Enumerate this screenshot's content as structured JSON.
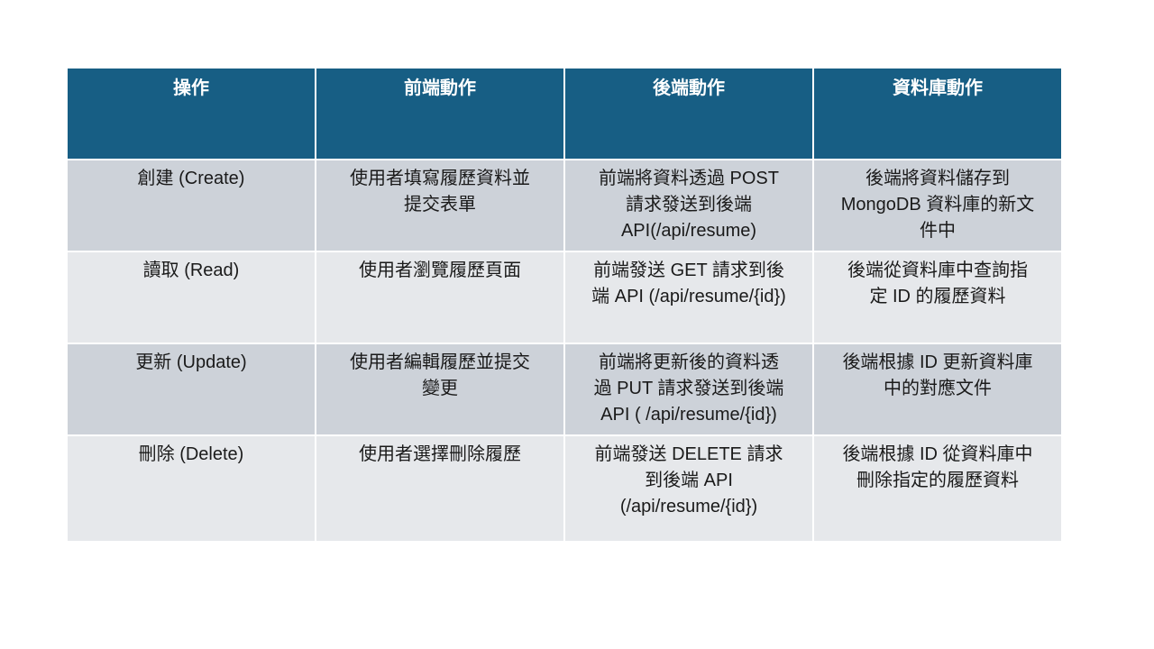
{
  "table": {
    "headers": [
      "操作",
      "前端動作",
      "後端動作",
      "資料庫動作"
    ],
    "rows": [
      [
        [
          "創建 (Create)"
        ],
        [
          "使用者填寫履歷資料並",
          "提交表單"
        ],
        [
          "前端將資料透過 POST",
          "請求發送到後端",
          "API(/api/resume)"
        ],
        [
          "後端將資料儲存到",
          "MongoDB 資料庫的新文",
          "件中"
        ]
      ],
      [
        [
          "讀取 (Read)"
        ],
        [
          "使用者瀏覽履歷頁面"
        ],
        [
          "前端發送 GET 請求到後",
          "端 API (/api/resume/{id})"
        ],
        [
          "後端從資料庫中查詢指",
          "定 ID 的履歷資料"
        ]
      ],
      [
        [
          "更新 (Update)"
        ],
        [
          "使用者編輯履歷並提交",
          "變更"
        ],
        [
          "前端將更新後的資料透",
          "過 PUT 請求發送到後端",
          "API ( /api/resume/{id})"
        ],
        [
          "後端根據 ID 更新資料庫",
          "中的對應文件"
        ]
      ],
      [
        [
          "刪除 (Delete)"
        ],
        [
          "使用者選擇刪除履歷"
        ],
        [
          "前端發送 DELETE 請求",
          "到後端 API",
          "(/api/resume/{id})"
        ],
        [
          "後端根據 ID 從資料庫中",
          "刪除指定的履歷資料"
        ]
      ]
    ]
  }
}
